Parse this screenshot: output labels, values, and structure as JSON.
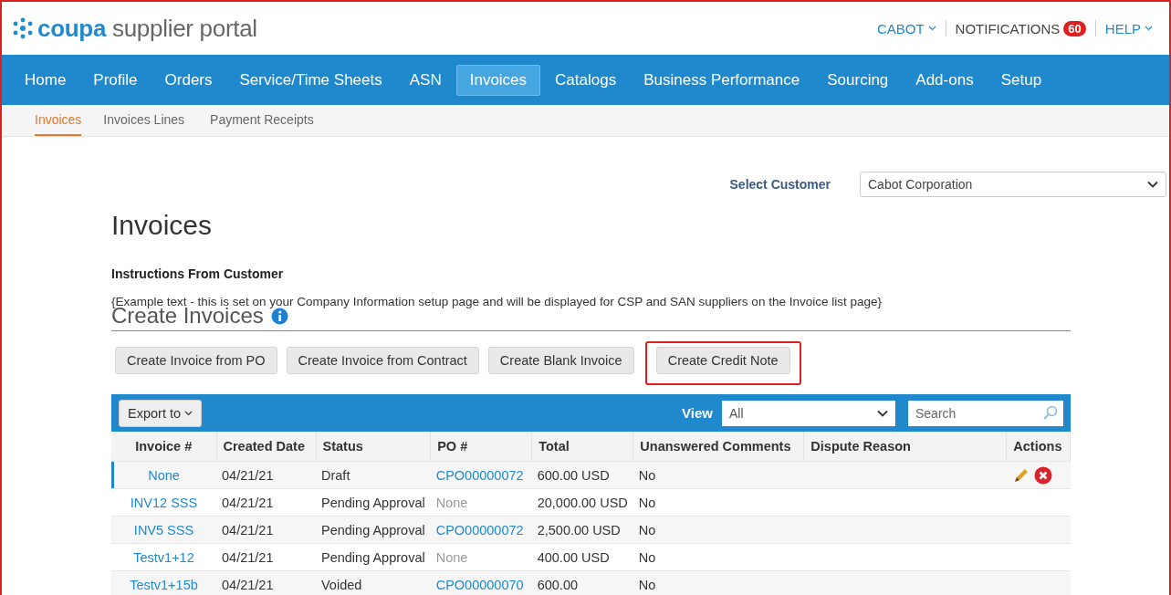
{
  "header": {
    "logo": "**coupa** supplier portal",
    "user_menu": "CABOT",
    "notifications": {
      "label": "NOTIFICATIONS",
      "count": "60"
    },
    "help_menu": "HELP"
  },
  "nav": [
    {
      "label": "Home",
      "selected": false
    },
    {
      "label": "Profile",
      "selected": false
    },
    {
      "label": "Orders",
      "selected": false
    },
    {
      "label": "Service/Time Sheets",
      "selected": false
    },
    {
      "label": "ASN",
      "selected": false
    },
    {
      "label": "Invoices",
      "selected": true
    },
    {
      "label": "Catalogs",
      "selected": false
    },
    {
      "label": "Business Performance",
      "selected": false
    },
    {
      "label": "Sourcing",
      "selected": false
    },
    {
      "label": "Add-ons",
      "selected": false
    },
    {
      "label": "Setup",
      "selected": false
    }
  ],
  "subnav": [
    {
      "label": "Invoices",
      "selected": true
    },
    {
      "label": "Invoices Lines",
      "selected": false
    },
    {
      "label": "Payment Receipts",
      "selected": false
    }
  ],
  "customer": {
    "label": "Select Customer",
    "value": "Cabot Corporation"
  },
  "page_title": "Invoices",
  "instructions": {
    "title": "Instructions From Customer",
    "text": "{Example text - this is set on your Company Information setup page and will be displayed for CSP and SAN suppliers on the Invoice list page}"
  },
  "create_section": {
    "title": "Create Invoices",
    "buttons": [
      {
        "label": "Create Invoice from PO",
        "highlighted": false
      },
      {
        "label": "Create Invoice from Contract",
        "highlighted": false
      },
      {
        "label": "Create Blank Invoice",
        "highlighted": false
      },
      {
        "label": "Create Credit Note",
        "highlighted": true
      }
    ]
  },
  "table": {
    "export": "Export to",
    "view_label": "View",
    "view_value": "All",
    "search": {
      "placeholder": "Search"
    },
    "columns": [
      "Invoice #",
      "Created Date",
      "Status",
      "PO #",
      "Total",
      "Unanswered Comments",
      "Dispute Reason",
      "Actions"
    ],
    "rows": [
      {
        "invoice": "None",
        "created": "04/21/21",
        "status": "Draft",
        "po": "CPO00000072",
        "po_linked": true,
        "total": "600.00 USD",
        "comments": "No",
        "selected": true,
        "editable": true
      },
      {
        "invoice": "INV12 SSS",
        "created": "04/21/21",
        "status": "Pending Approval",
        "po": "None",
        "po_linked": false,
        "total": "20,000.00 USD",
        "comments": "No",
        "selected": false,
        "editable": false
      },
      {
        "invoice": "INV5 SSS",
        "created": "04/21/21",
        "status": "Pending Approval",
        "po": "CPO00000072",
        "po_linked": true,
        "total": "2,500.00 USD",
        "comments": "No",
        "selected": false,
        "editable": false
      },
      {
        "invoice": "Testv1+12",
        "created": "04/21/21",
        "status": "Pending Approval",
        "po": "None",
        "po_linked": false,
        "total": "400.00 USD",
        "comments": "No",
        "selected": false,
        "editable": false
      },
      {
        "invoice": "Testv1+15b",
        "created": "04/21/21",
        "status": "Voided",
        "po": "CPO00000070",
        "po_linked": true,
        "total": "600.00",
        "comments": "No",
        "selected": false,
        "editable": false
      }
    ]
  }
}
